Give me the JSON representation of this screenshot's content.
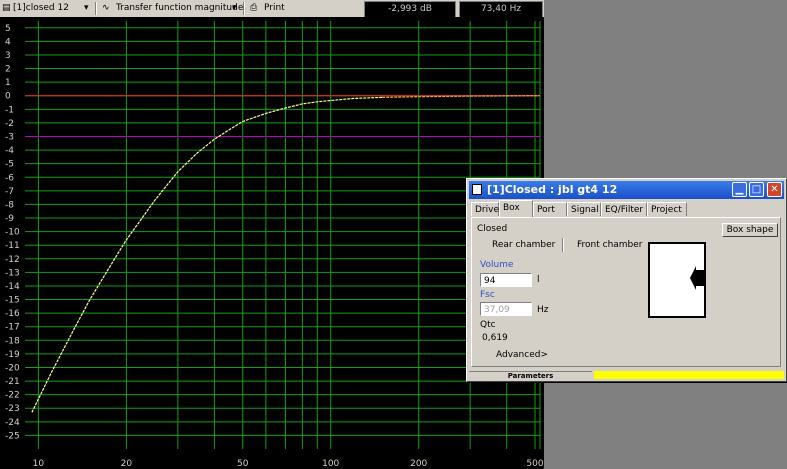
{
  "toolbar": {
    "curve_select": "[1]closed 12",
    "graph_select": "Transfer function magnitude",
    "print_label": "Print",
    "readout_db": "-2,993 dB",
    "readout_hz": "73,40 Hz"
  },
  "chart_data": {
    "type": "line",
    "x_scale": "log",
    "xlim": [
      9,
      520
    ],
    "ylim": [
      -26,
      5.5
    ],
    "x_ticks": [
      10,
      20,
      50,
      100,
      200,
      500
    ],
    "x_tick_labels": [
      "10",
      "20",
      "50",
      "100",
      "200",
      "500"
    ],
    "y_ticks": [
      5,
      4,
      3,
      2,
      1,
      0,
      -1,
      -2,
      -3,
      -4,
      -5,
      -6,
      -7,
      -8,
      -9,
      -10,
      -11,
      -12,
      -13,
      -14,
      -15,
      -16,
      -17,
      -18,
      -19,
      -20,
      -21,
      -22,
      -23,
      -24,
      -25
    ],
    "reference_lines": [
      {
        "y": 0,
        "color": "#ff2020"
      },
      {
        "y": -3,
        "color": "#c000c0"
      }
    ],
    "series": [
      {
        "color": "#ffff80",
        "x": [
          9.5,
          11,
          13,
          15,
          18,
          20,
          25,
          30,
          35,
          40,
          45,
          50,
          60,
          70,
          80,
          90,
          100,
          120,
          150
        ],
        "y": [
          -23.3,
          -20.5,
          -17.5,
          -15.0,
          -12.2,
          -10.6,
          -7.7,
          -5.6,
          -4.2,
          -3.2,
          -2.5,
          -1.9,
          -1.3,
          -0.9,
          -0.6,
          -0.45,
          -0.35,
          -0.2,
          -0.12
        ]
      },
      {
        "color": "#ffa040",
        "x": [
          150,
          200,
          300,
          400,
          520
        ],
        "y": [
          -0.12,
          -0.07,
          -0.03,
          -0.01,
          0
        ]
      }
    ],
    "colors": {
      "background": "#000000",
      "grid": "#10a010",
      "axis_text": "#d4d0c8"
    }
  },
  "dialog": {
    "title": "[1]Closed : jbl gt4 12",
    "tabs": [
      "Driver",
      "Box",
      "Port",
      "Signal",
      "EQ/Filter",
      "Project"
    ],
    "active_tab": "Box",
    "box_type": "Closed",
    "box_shape_button": "Box shape",
    "rear_chamber": "Rear chamber",
    "front_chamber": "Front chamber",
    "volume_label": "Volume",
    "volume_value": "94",
    "volume_unit": "l",
    "fsc_label": "Fsc",
    "fsc_value": "37,09",
    "fsc_unit": "Hz",
    "qtc_label": "Qtc",
    "qtc_value": "0,619",
    "advanced_button": "Advanced>",
    "status_label": "Parameters"
  }
}
